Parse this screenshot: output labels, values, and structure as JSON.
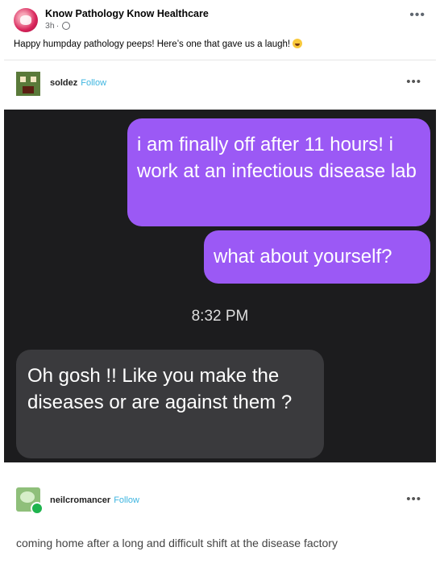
{
  "post": {
    "page_name": "Know Pathology Know Healthcare",
    "time": "3h",
    "caption": "Happy humpday pathology peeps! Here’s one that gave us a laugh!"
  },
  "card": {
    "user1": "soldez",
    "follow": "Follow",
    "chat": {
      "out1": "i am finally off after 11 hours! i work at an infectious disease lab",
      "out2": "what about yourself?",
      "time": "8:32 PM",
      "in1": "Oh gosh !! Like you make the diseases or are against them ?"
    },
    "user2": "neilcromancer",
    "reply": "coming home after a long and difficult shift at the disease factory"
  },
  "icons": {
    "more": "more-horizontal-icon",
    "globe": "globe-icon",
    "emoji": "laughing-emoji-icon"
  },
  "colors": {
    "outgoing_bubble": "#9b59f5",
    "incoming_bubble": "#3a3a3d",
    "chat_background": "#1c1c1e",
    "follow_link": "#3db5e0"
  }
}
